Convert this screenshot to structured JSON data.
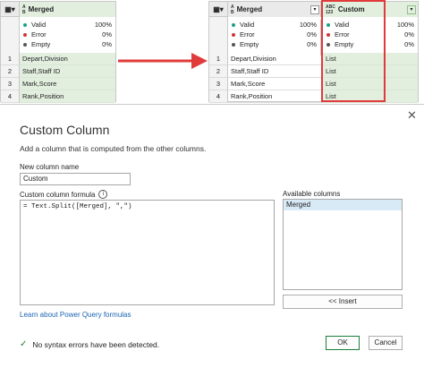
{
  "left_table": {
    "column_header": "Merged",
    "type_icon": "ABC",
    "quality": [
      {
        "label": "Valid",
        "value": "100%",
        "color": "#1aa08a"
      },
      {
        "label": "Error",
        "value": "0%",
        "color": "#d13438"
      },
      {
        "label": "Empty",
        "value": "0%",
        "color": "#555555"
      }
    ],
    "rows": [
      {
        "num": "1",
        "value": "Depart,Division"
      },
      {
        "num": "2",
        "value": "Staff,Staff ID"
      },
      {
        "num": "3",
        "value": "Mark,Score"
      },
      {
        "num": "4",
        "value": "Rank,Position"
      }
    ]
  },
  "right_table": {
    "merged_header": "Merged",
    "custom_header": "Custom",
    "custom_type_icon": "ABC 123",
    "merged_quality": [
      {
        "label": "Valid",
        "value": "100%",
        "color": "#1aa08a"
      },
      {
        "label": "Error",
        "value": "0%",
        "color": "#d13438"
      },
      {
        "label": "Empty",
        "value": "0%",
        "color": "#555555"
      }
    ],
    "custom_quality": [
      {
        "label": "Valid",
        "value": "100%",
        "color": "#1aa08a"
      },
      {
        "label": "Error",
        "value": "0%",
        "color": "#d13438"
      },
      {
        "label": "Empty",
        "value": "0%",
        "color": "#555555"
      }
    ],
    "rows": [
      {
        "num": "1",
        "merged": "Depart,Division",
        "custom": "List"
      },
      {
        "num": "2",
        "merged": "Staff,Staff ID",
        "custom": "List"
      },
      {
        "num": "3",
        "merged": "Mark,Score",
        "custom": "List"
      },
      {
        "num": "4",
        "merged": "Rank,Position",
        "custom": "List"
      }
    ]
  },
  "colors": {
    "arrow": "#e03a3a",
    "highlight": "#e03a3a",
    "green_fill": "#e2efdf",
    "ok_border": "#1a7f37"
  },
  "dialog": {
    "title": "Custom Column",
    "subtitle": "Add a column that is computed from the other columns.",
    "new_column_label": "New column name",
    "new_column_value": "Custom",
    "formula_label": "Custom column formula",
    "formula_text": "Text.Split([Merged], \",\")",
    "available_label": "Available columns",
    "available_items": [
      "Merged"
    ],
    "insert_button": "<< Insert",
    "learn_link": "Learn about Power Query formulas",
    "status_text": "No syntax errors have been detected.",
    "ok_button": "OK",
    "cancel_button": "Cancel"
  }
}
